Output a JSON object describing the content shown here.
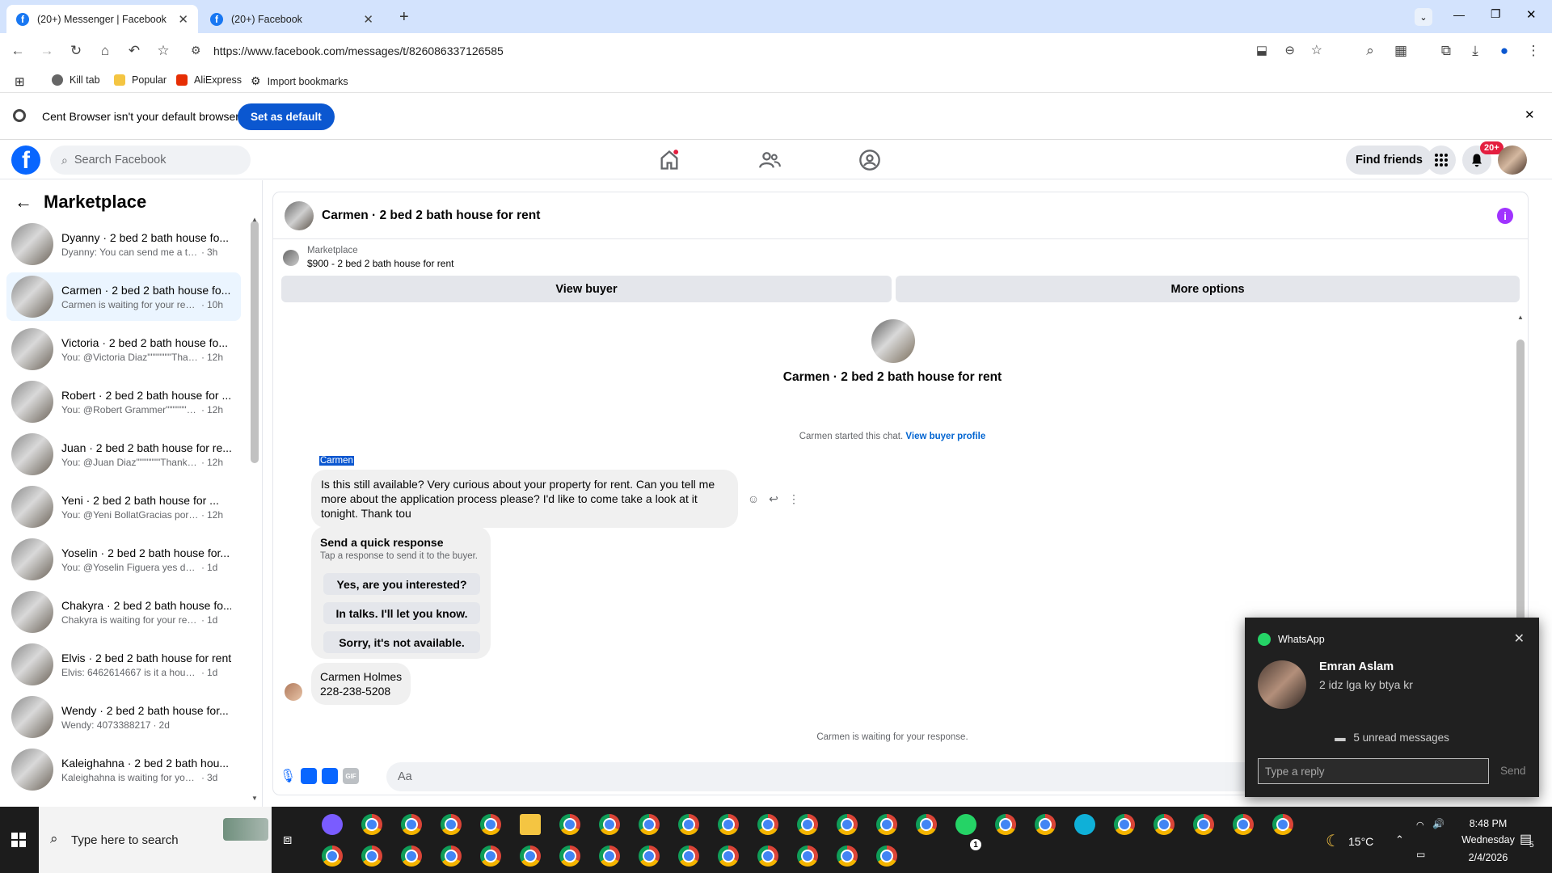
{
  "browser": {
    "tabs": [
      {
        "title": "(20+) Messenger | Facebook",
        "active": true
      },
      {
        "title": "(20+) Facebook",
        "active": false
      }
    ],
    "new_tab": "+",
    "url": "https://www.facebook.com/messages/t/826086337126585",
    "bookmarks": [
      "Kill tab",
      "Popular",
      "AliExpress",
      "Import bookmarks"
    ],
    "default_bar": {
      "text": "Cent Browser isn't your default browser",
      "button": "Set as default"
    }
  },
  "facebook": {
    "search_placeholder": "Search Facebook",
    "find_friends": "Find friends",
    "notif_badge": "20+"
  },
  "sidebar": {
    "title": "Marketplace",
    "conversations": [
      {
        "name": "Dyanny · 2 bed 2 bath house fo...",
        "preview": "Dyanny: You can send me a text m...",
        "time": "3h",
        "selected": false
      },
      {
        "name": "Carmen · 2 bed 2 bath house fo...",
        "preview": "Carmen is waiting for your respo...",
        "time": "10h",
        "selected": true
      },
      {
        "name": "Victoria · 2 bed 2 bath house fo...",
        "preview": "You: @Victoria Diaz\"\"\"\"\"\"\"Thank y...",
        "time": "12h",
        "selected": false
      },
      {
        "name": "Robert · 2 bed 2 bath house for ...",
        "preview": "You: @Robert Grammer\"\"\"\"\"\"\"Tha...",
        "time": "12h",
        "selected": false
      },
      {
        "name": "Juan · 2 bed 2 bath house for re...",
        "preview": "You: @Juan Diaz\"\"\"\"\"\"\"Thank you ...",
        "time": "12h",
        "selected": false
      },
      {
        "name": "Yeni · 2 bed 2 bath house for ...",
        "preview": "You: @Yeni BollatGracias por s...",
        "time": "12h",
        "selected": false
      },
      {
        "name": "Yoselin · 2 bed 2 bath house for...",
        "preview": "You: @Yoselin Figuera yes dear its ...",
        "time": "1d",
        "selected": false
      },
      {
        "name": "Chakyra · 2 bed 2 bath house fo...",
        "preview": "Chakyra is waiting for your respon...",
        "time": "1d",
        "selected": false
      },
      {
        "name": "Elvis · 2 bed 2 bath house for rent",
        "preview": "Elvis: 6462614667 is it a house or a...",
        "time": "1d",
        "selected": false
      },
      {
        "name": "Wendy · 2 bed 2 bath house for...",
        "preview": "Wendy: 4073388217",
        "time": "2d",
        "selected": false
      },
      {
        "name": "Kaleighahna · 2 bed 2 bath hou...",
        "preview": "Kaleighahna is waiting for your res...",
        "time": "3d",
        "selected": false
      }
    ]
  },
  "chat": {
    "header_title": "Carmen · 2 bed 2 bath house for rent",
    "marketplace_label": "Marketplace",
    "listing": "$900 - 2 bed 2 bath house for rent",
    "view_buyer": "View buyer",
    "more_options": "More options",
    "conversation_title": "Carmen · 2 bed 2 bath house for rent",
    "started_text": "Carmen started this chat.",
    "view_buyer_profile": "View buyer profile",
    "sender_name": "Carmen",
    "message1": "Is this still available? Very curious about your property for rent. Can you tell me more about the application process please?  I'd like to come take a look at it tonight. Thank tou",
    "quick_response": {
      "title": "Send a quick response",
      "subtitle": "Tap a response to send it to the buyer.",
      "options": [
        "Yes, are you interested?",
        "In talks. I'll let you know.",
        "Sorry, it's not available."
      ]
    },
    "message2_line1": "Carmen Holmes",
    "message2_line2": "228-238-5208",
    "waiting_text": "Carmen is waiting for your response.",
    "composer_placeholder": "Aa"
  },
  "whatsapp": {
    "app": "WhatsApp",
    "sender": "Emran Aslam",
    "message": "2 idz lga ky btya kr",
    "unread": "5 unread messages",
    "reply_placeholder": "Type a reply",
    "send": "Send"
  },
  "taskbar": {
    "search_placeholder": "Type here to search",
    "weather": "15°C",
    "time": "8:48 PM",
    "day": "Wednesday",
    "date": "2/4/2026",
    "whatsapp_badge": "1",
    "notif_count": "5"
  },
  "colors": {
    "fb_blue": "#0866ff",
    "chrome_tabstrip": "#d3e3fd",
    "selected_conv": "#ebf5ff",
    "taskbar": "#1c1c1c"
  }
}
